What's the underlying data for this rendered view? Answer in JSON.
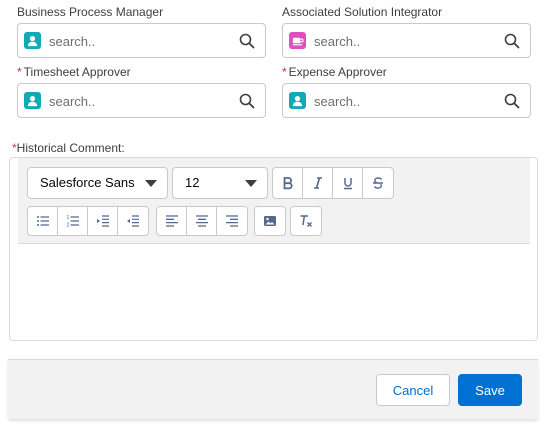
{
  "fields": [
    {
      "label": "Business Process Manager",
      "required": false,
      "placeholder": "search..",
      "icon": "contact-icon",
      "icon_color": "#12a9b4"
    },
    {
      "label": "Associated Solution Integrator",
      "required": false,
      "placeholder": "search..",
      "icon": "custom-object-icon",
      "icon_color": "#e04fbe"
    },
    {
      "label": "Timesheet Approver",
      "required": true,
      "placeholder": "search..",
      "icon": "contact-icon",
      "icon_color": "#12a9b4"
    },
    {
      "label": "Expense Approver",
      "required": true,
      "placeholder": "search..",
      "icon": "contact-icon",
      "icon_color": "#12a9b4"
    }
  ],
  "required_marker": "*",
  "comment": {
    "label": "Historical Comment:",
    "required": true
  },
  "editor": {
    "font_family_value": "Salesforce Sans",
    "font_size_value": "12",
    "format_buttons": [
      "bold",
      "italic",
      "underline",
      "strikethrough"
    ],
    "list_buttons": [
      "bulleted-list",
      "numbered-list",
      "indent",
      "outdent"
    ],
    "align_buttons": [
      "align-left",
      "align-center",
      "align-right"
    ],
    "insert_buttons": [
      "insert-image"
    ],
    "clear_buttons": [
      "remove-formatting"
    ]
  },
  "footer": {
    "cancel_label": "Cancel",
    "save_label": "Save"
  },
  "colors": {
    "brand": "#0070d2",
    "required": "#c23934"
  }
}
